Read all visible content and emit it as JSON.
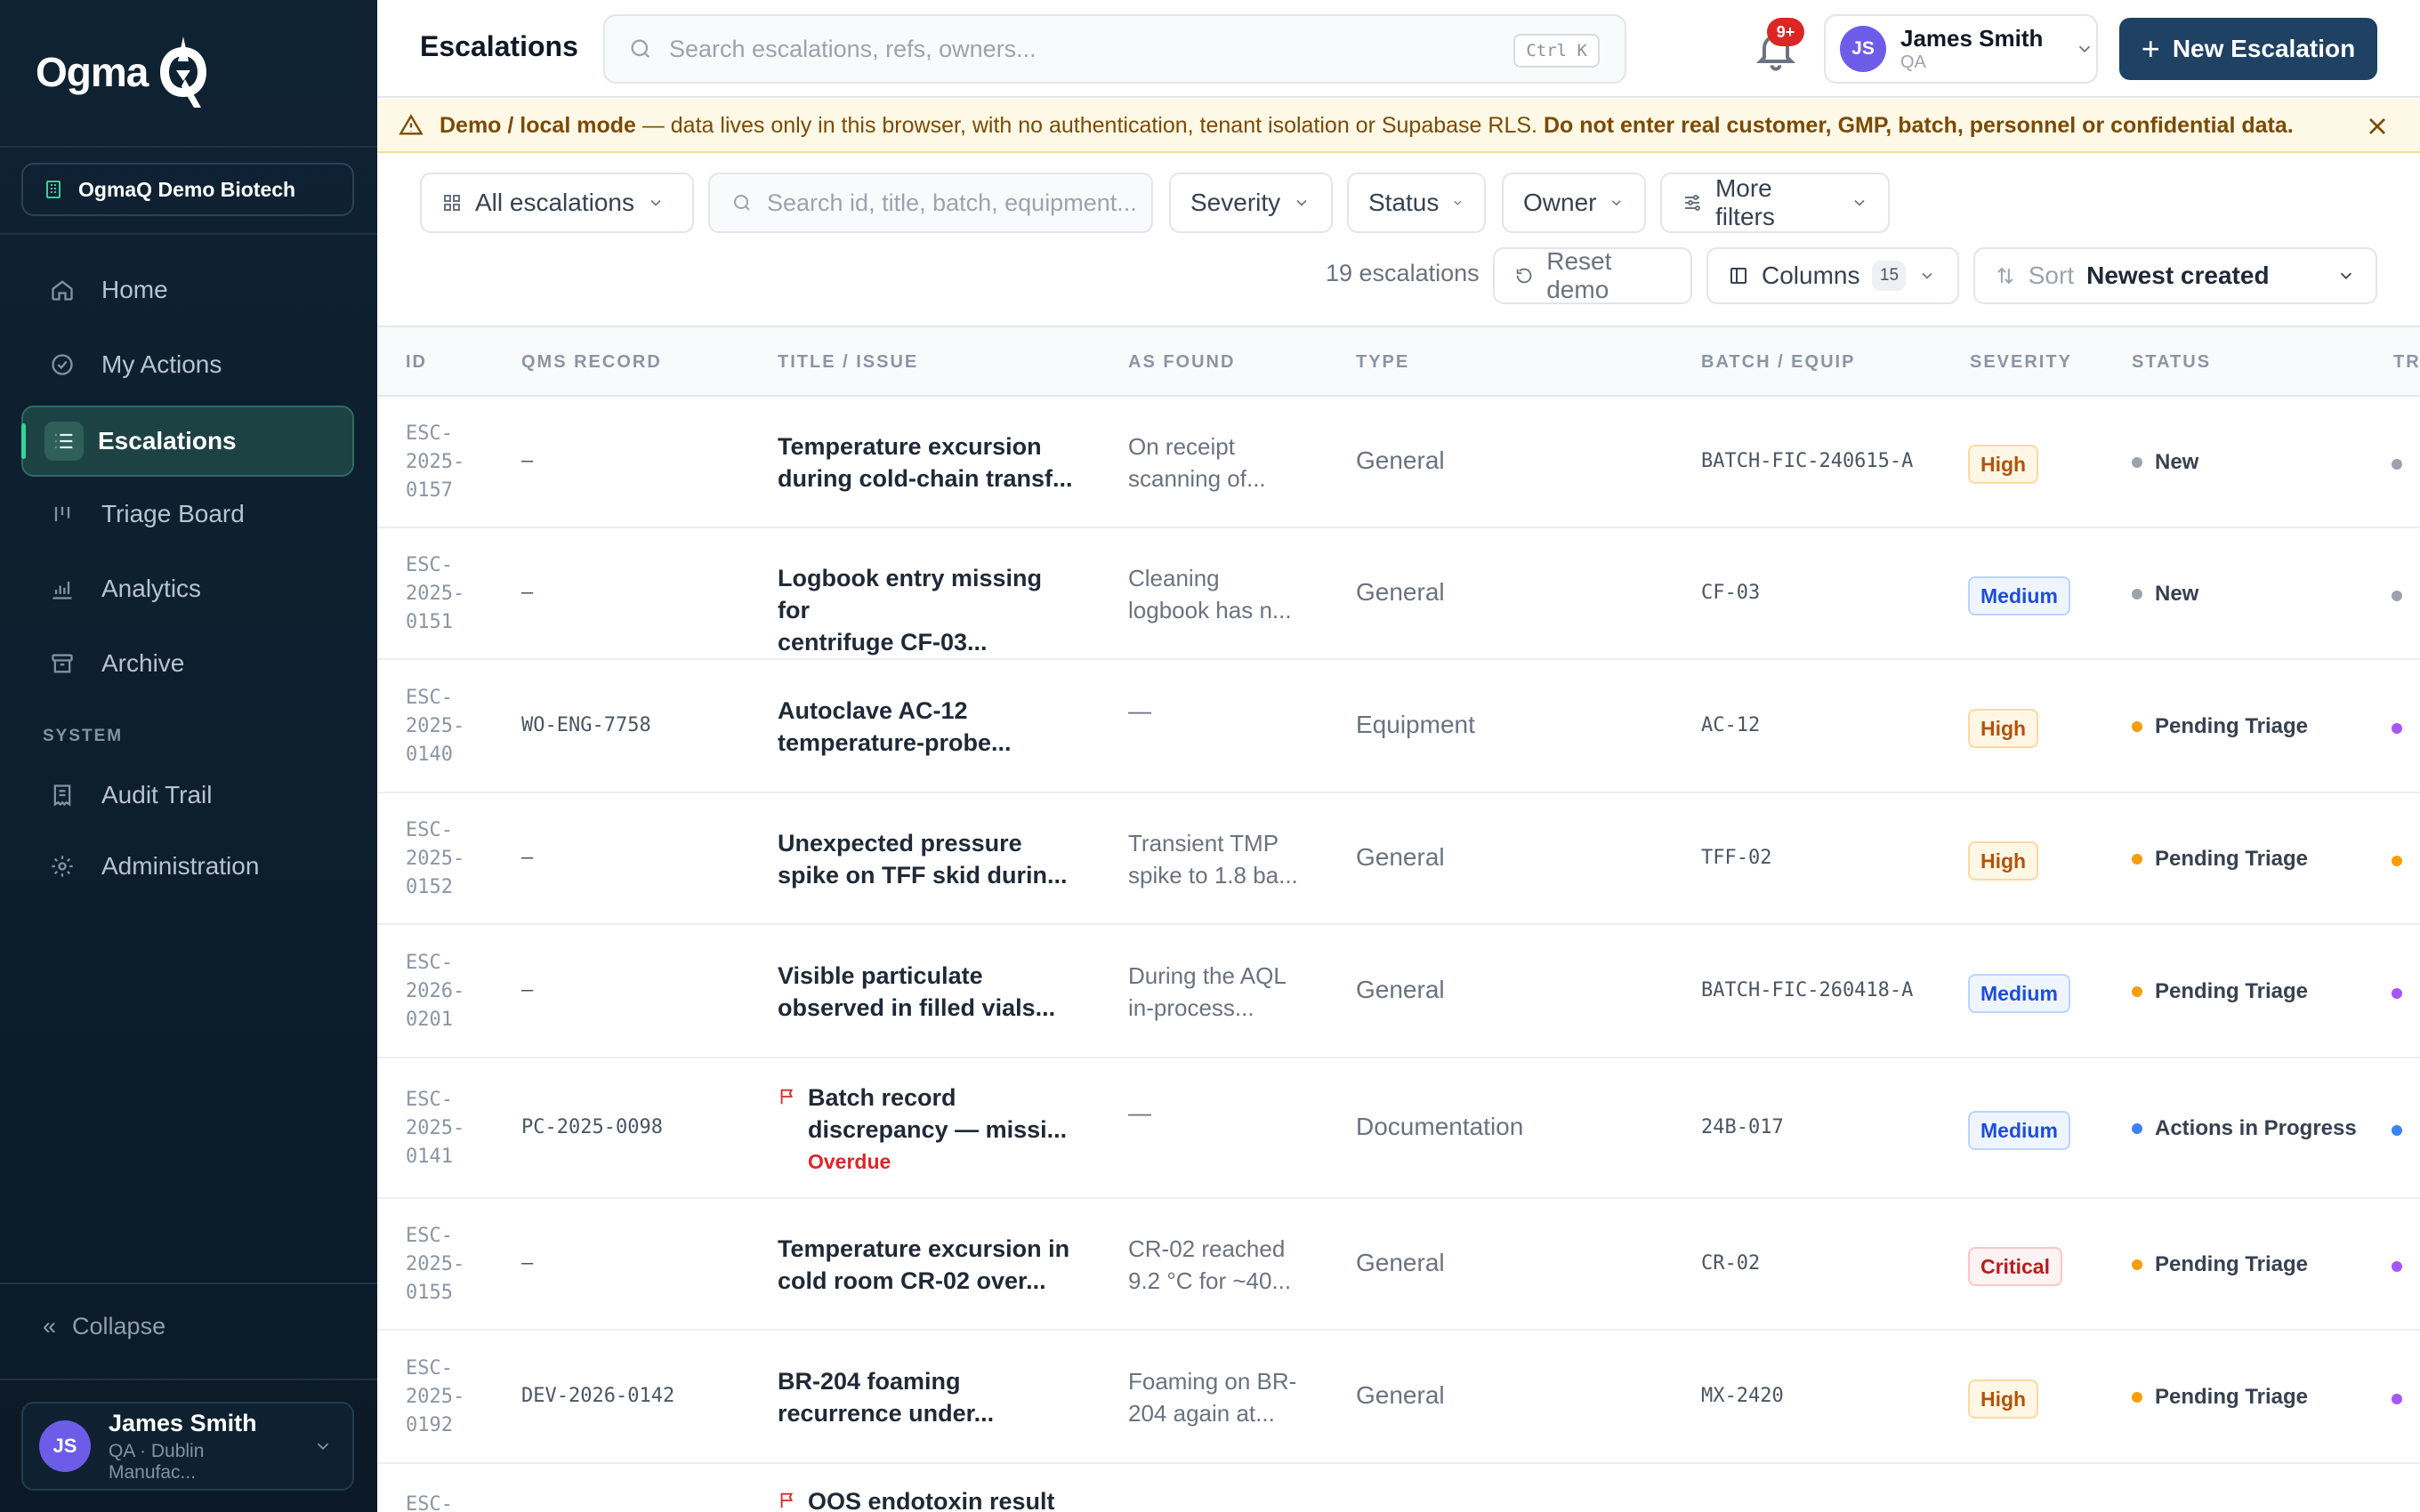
{
  "sidebar": {
    "logo_text": "Ogma",
    "tenant": "OgmaQ Demo Biotech",
    "nav": [
      {
        "label": "Home",
        "icon": "home-icon"
      },
      {
        "label": "My Actions",
        "icon": "check-circle-icon"
      },
      {
        "label": "Escalations",
        "icon": "list-icon",
        "active": true
      },
      {
        "label": "Triage Board",
        "icon": "kanban-icon"
      },
      {
        "label": "Analytics",
        "icon": "bar-chart-icon"
      },
      {
        "label": "Archive",
        "icon": "archive-icon"
      }
    ],
    "system_label": "SYSTEM",
    "system_nav": [
      {
        "label": "Audit Trail",
        "icon": "receipt-icon"
      },
      {
        "label": "Administration",
        "icon": "gear-icon"
      }
    ],
    "collapse_label": "Collapse",
    "user": {
      "initials": "JS",
      "name": "James Smith",
      "sub": "QA · Dublin Manufac..."
    }
  },
  "topbar": {
    "title": "Escalations",
    "search_placeholder": "Search escalations, refs, owners...",
    "shortcut": "Ctrl K",
    "notifications": "9+",
    "user": {
      "initials": "JS",
      "name": "James Smith",
      "role": "QA"
    },
    "new_button": "New Escalation"
  },
  "banner": {
    "lead": "Demo / local mode",
    "text": " — data lives only in this browser, with no authentication, tenant isolation or Supabase RLS. ",
    "warning": "Do not enter real customer, GMP, batch, personnel or confidential data."
  },
  "filters": {
    "view": "All escalations",
    "search_placeholder": "Search id, title, batch, equipment...",
    "severity": "Severity",
    "status": "Status",
    "owner": "Owner",
    "more": "More filters",
    "count": "19 escalations",
    "reset": "Reset demo",
    "columns": "Columns",
    "columns_count": "15",
    "sort_label": "Sort",
    "sort_value": "Newest created"
  },
  "table": {
    "headers": [
      "ID",
      "QMS RECORD",
      "TITLE / ISSUE",
      "AS FOUND",
      "TYPE",
      "BATCH / EQUIP",
      "SEVERITY",
      "STATUS",
      "TR"
    ],
    "rows": [
      {
        "id": [
          "ESC-",
          "2025-",
          "0157"
        ],
        "qms": "—",
        "title": [
          "Temperature excursion",
          "during cold-chain transf..."
        ],
        "found": [
          "On receipt",
          "scanning of..."
        ],
        "type": "General",
        "batch": "BATCH-FIC-240615-A",
        "severity": "High",
        "status": "New",
        "status_color": "#9ca3af",
        "tr_color": "#9ca3af"
      },
      {
        "id": [
          "ESC-",
          "2025-",
          "0151"
        ],
        "qms": "—",
        "title": [
          "Logbook entry missing for",
          "centrifuge CF-03..."
        ],
        "found": [
          "Cleaning",
          "logbook has n..."
        ],
        "type": "General",
        "batch": "CF-03",
        "severity": "Medium",
        "status": "New",
        "status_color": "#9ca3af",
        "tr_color": "#9ca3af"
      },
      {
        "id": [
          "ESC-",
          "2025-",
          "0140"
        ],
        "qms": "WO-ENG-7758",
        "title": [
          "Autoclave AC-12",
          "temperature-probe..."
        ],
        "found": [
          "—",
          ""
        ],
        "type": "Equipment",
        "batch": "AC-12",
        "severity": "High",
        "status": "Pending Triage",
        "status_color": "#f59e0b",
        "tr_color": "#a855f7"
      },
      {
        "id": [
          "ESC-",
          "2025-",
          "0152"
        ],
        "qms": "—",
        "title": [
          "Unexpected pressure",
          "spike on TFF skid durin..."
        ],
        "found": [
          "Transient TMP",
          "spike to 1.8 ba..."
        ],
        "type": "General",
        "batch": "TFF-02",
        "severity": "High",
        "status": "Pending Triage",
        "status_color": "#f59e0b",
        "tr_color": "#f59e0b"
      },
      {
        "id": [
          "ESC-",
          "2026-",
          "0201"
        ],
        "qms": "—",
        "title": [
          "Visible particulate",
          "observed in filled vials..."
        ],
        "found": [
          "During the AQL",
          "in-process..."
        ],
        "type": "General",
        "batch": "BATCH-FIC-260418-A",
        "severity": "Medium",
        "status": "Pending Triage",
        "status_color": "#f59e0b",
        "tr_color": "#a855f7"
      },
      {
        "id": [
          "ESC-",
          "2025-",
          "0141"
        ],
        "qms": "PC-2025-0098",
        "title": [
          "Batch record",
          "discrepancy — missi..."
        ],
        "flag": true,
        "tag": "Overdue",
        "found": [
          "—",
          ""
        ],
        "type": "Documentation",
        "batch": "24B-017",
        "severity": "Medium",
        "status": "Actions in Progress",
        "status_color": "#3b82f6",
        "tr_color": "#3b82f6"
      },
      {
        "id": [
          "ESC-",
          "2025-",
          "0155"
        ],
        "qms": "—",
        "title": [
          "Temperature excursion in",
          "cold room CR-02 over..."
        ],
        "found": [
          "CR-02 reached",
          "9.2 °C for ~40..."
        ],
        "type": "General",
        "batch": "CR-02",
        "severity": "Critical",
        "status": "Pending Triage",
        "status_color": "#f59e0b",
        "tr_color": "#a855f7"
      },
      {
        "id": [
          "ESC-",
          "2025-",
          "0192"
        ],
        "qms": "DEV-2026-0142",
        "title": [
          "BR-204 foaming",
          "recurrence under..."
        ],
        "found": [
          "Foaming on BR-",
          "204 again at..."
        ],
        "type": "General",
        "batch": "MX-2420",
        "severity": "High",
        "status": "Pending Triage",
        "status_color": "#f59e0b",
        "tr_color": "#a855f7"
      },
      {
        "id": [
          "ESC-",
          "",
          ""
        ],
        "qms": "",
        "title": [
          "OOS endotoxin result",
          ""
        ],
        "flag": true,
        "found": [
          "",
          ""
        ],
        "type": "",
        "batch": "",
        "severity": "",
        "status": "",
        "status_color": "#ffffff",
        "tr_color": "#ffffff"
      }
    ]
  },
  "colors": {
    "sidebar": "#0f2233",
    "accent": "#1e4164",
    "active_nav": "#1d4244",
    "banner": "#fef9e7"
  }
}
